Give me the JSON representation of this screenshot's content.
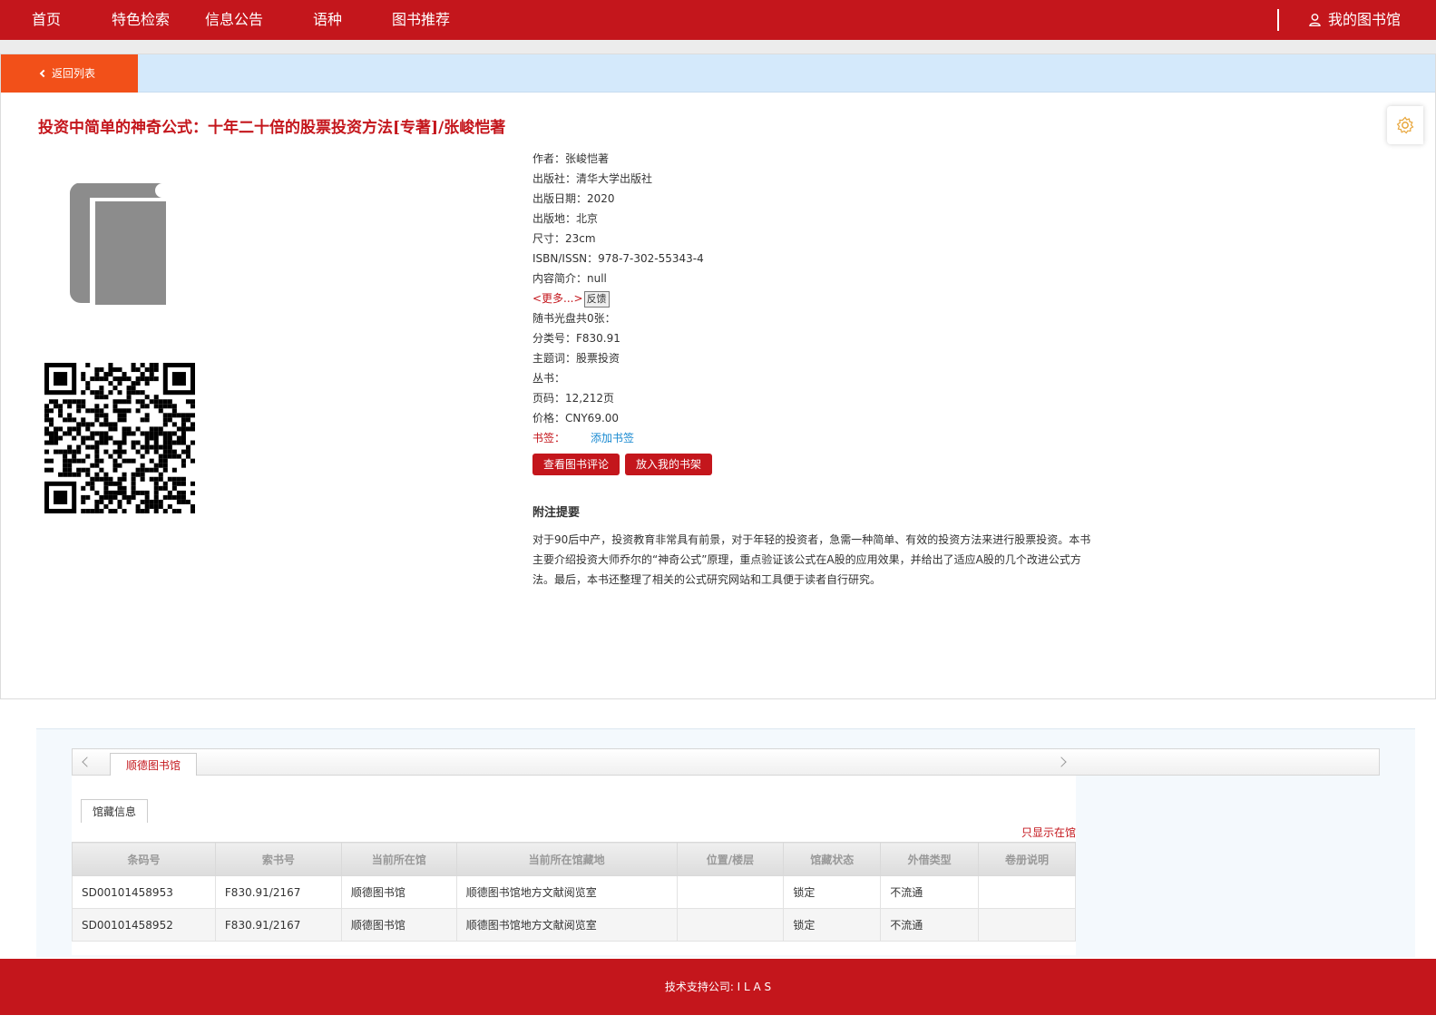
{
  "nav": {
    "items": [
      "首页",
      "特色检索",
      "信息公告",
      "语种",
      "图书推荐"
    ],
    "my_library": "我的图书馆"
  },
  "back_label": "返回列表",
  "book": {
    "title": "投资中简单的神奇公式：十年二十倍的股票投资方法[专著]/张峻恺著",
    "rows": [
      "作者：张峻恺著",
      "出版社：清华大学出版社",
      "出版日期：2020",
      "出版地：北京",
      "尺寸：23cm",
      "ISBN/ISSN：978-7-302-55343-4",
      "内容简介：null"
    ],
    "more_label": "<更多...>",
    "feedback_label": "反馈",
    "rows2": [
      "随书光盘共0张：",
      "分类号：F830.91",
      "主题词：股票投资",
      "丛书：",
      "页码：12,212页",
      "价格：CNY69.00"
    ],
    "bookmark_label": "书签：",
    "bookmark_add": "添加书签",
    "btn_reviews": "查看图书评论",
    "btn_shelf": "放入我的书架",
    "notes_heading": "附注提要",
    "notes_text": "对于90后中产，投资教育非常具有前景，对于年轻的投资者，急需一种简单、有效的投资方法来进行股票投资。本书主要介绍投资大师乔尔的“神奇公式”原理，重点验证该公式在A股的应用效果，并给出了适应A股的几个改进公式方法。最后，本书还整理了相关的公式研究网站和工具便于读者自行研究。"
  },
  "holdings": {
    "library_tab": "顺德图书馆",
    "sub_tab": "馆藏信息",
    "only_in_lib": "只显示在馆",
    "columns": [
      "条码号",
      "索书号",
      "当前所在馆",
      "当前所在馆藏地",
      "位置/楼层",
      "馆藏状态",
      "外借类型",
      "卷册说明"
    ],
    "rows": [
      [
        "SD00101458953",
        "F830.91/2167",
        "顺德图书馆",
        "顺德图书馆地方文献阅览室",
        "",
        "锁定",
        "不流通",
        ""
      ],
      [
        "SD00101458952",
        "F830.91/2167",
        "顺德图书馆",
        "顺德图书馆地方文献阅览室",
        "",
        "锁定",
        "不流通",
        ""
      ]
    ]
  },
  "footer": "技术支持公司: I L A S",
  "colors": {
    "brand_red": "#c4161c",
    "back_orange": "#f25019",
    "bar_blue": "#d4e9fb",
    "link_blue": "#1a8ad1"
  }
}
